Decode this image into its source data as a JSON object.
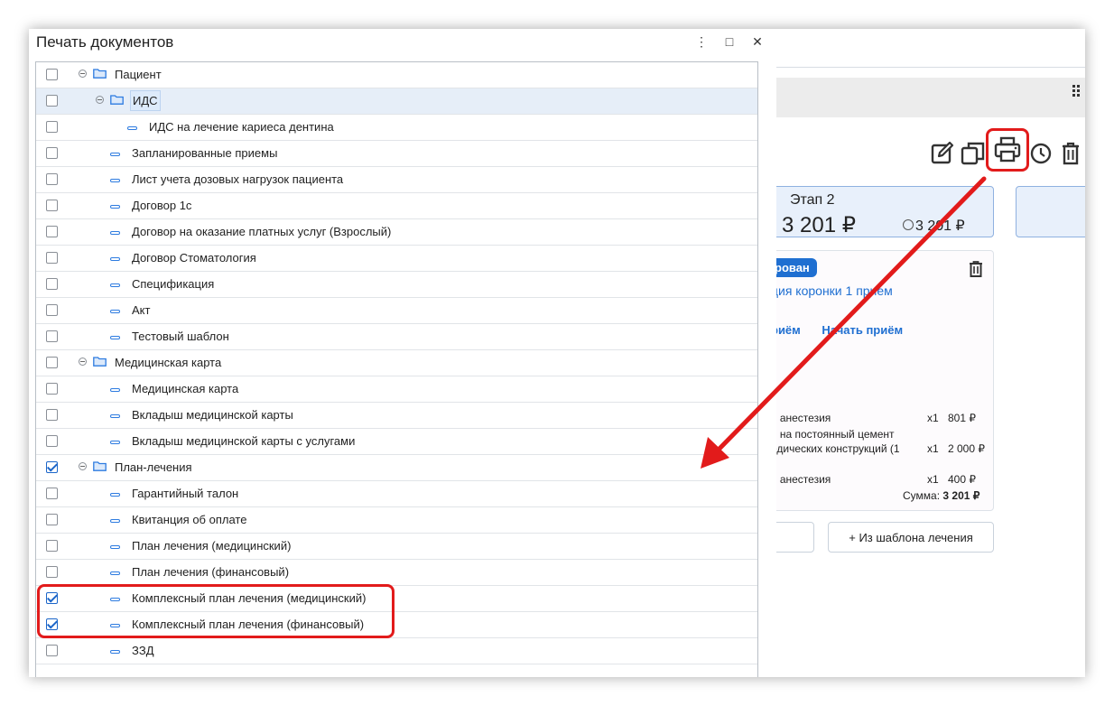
{
  "dialog": {
    "title": "Печать документов",
    "controls": {
      "menu": "⋮",
      "maximize": "□",
      "close": "✕"
    },
    "rows": [
      {
        "label": "Пациент",
        "type": "folder",
        "checked": false
      },
      {
        "label": "ИДС",
        "type": "folder",
        "checked": false
      },
      {
        "label": "ИДС на лечение кариеса дентина",
        "type": "doc",
        "checked": false
      },
      {
        "label": "Запланированные приемы",
        "type": "doc",
        "checked": false
      },
      {
        "label": "Лист учета дозовых нагрузок пациента",
        "type": "doc",
        "checked": false
      },
      {
        "label": "Договор 1с",
        "type": "doc",
        "checked": false
      },
      {
        "label": "Договор на оказание платных услуг (Взрослый)",
        "type": "doc",
        "checked": false
      },
      {
        "label": "Договор Стоматология",
        "type": "doc",
        "checked": false
      },
      {
        "label": "Спецификация",
        "type": "doc",
        "checked": false
      },
      {
        "label": "Акт",
        "type": "doc",
        "checked": false
      },
      {
        "label": "Тестовый шаблон",
        "type": "doc",
        "checked": false
      },
      {
        "label": "Медицинская карта",
        "type": "folder",
        "checked": false
      },
      {
        "label": "Медицинская карта",
        "type": "doc",
        "checked": false
      },
      {
        "label": "Вкладыш медицинской карты",
        "type": "doc",
        "checked": false
      },
      {
        "label": "Вкладыш медицинской карты с услугами",
        "type": "doc",
        "checked": false
      },
      {
        "label": "План-лечения",
        "type": "folder",
        "checked": true
      },
      {
        "label": "Гарантийный талон",
        "type": "doc",
        "checked": false
      },
      {
        "label": "Квитанция об оплате",
        "type": "doc",
        "checked": false
      },
      {
        "label": "План лечения (медицинский)",
        "type": "doc",
        "checked": false
      },
      {
        "label": "План лечения (финансовый)",
        "type": "doc",
        "checked": false
      },
      {
        "label": "Комплексный план лечения (медицинский)",
        "type": "doc",
        "checked": true
      },
      {
        "label": "Комплексный план лечения (финансовый)",
        "type": "doc",
        "checked": true
      },
      {
        "label": "ЗЗД",
        "type": "doc",
        "checked": false
      }
    ]
  },
  "background": {
    "stage": {
      "title": "Этап 2",
      "price": "3 201 ₽",
      "paid": "3 201 ₽"
    },
    "visit": {
      "status": "рован",
      "title": "ция коронки 1 прием",
      "link_1": "риём",
      "link_2": "Начать приём",
      "services": [
        {
          "name": "я анестезия",
          "qty": "x1",
          "price": "801 ₽"
        },
        {
          "name": "я на постоянный цемент",
          "name2": "едических конструкций (1",
          "qty": "x1",
          "price": "2 000 ₽"
        },
        {
          "name": "я анестезия",
          "qty": "x1",
          "price": "400 ₽"
        }
      ],
      "sum_label": "Сумма:",
      "sum_value": "3 201 ₽"
    },
    "from_template_button": "+ Из шаблона лечения"
  },
  "colors": {
    "accent": "#1f6fd1",
    "annotation": "#e21b1b",
    "selected_row": "#e6eef8"
  },
  "icons": [
    "edit-icon",
    "copy-icon",
    "printer-icon",
    "history-icon",
    "trash-icon",
    "grid-icon",
    "folder-icon",
    "document-icon"
  ]
}
